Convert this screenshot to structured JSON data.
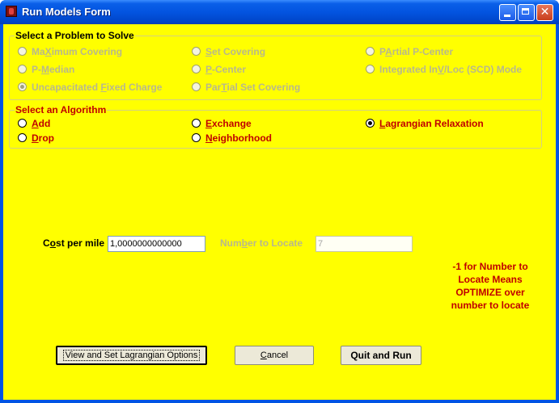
{
  "window": {
    "title": "Run Models Form",
    "controls": {
      "minimize": "minimize",
      "maximize": "maximize",
      "close": "✕"
    }
  },
  "problem_group": {
    "title": "Select a Problem to Solve",
    "options": [
      {
        "pre": "Ma",
        "u": "X",
        "post": "imum Covering",
        "selected": false
      },
      {
        "pre": "",
        "u": "S",
        "post": "et Covering",
        "selected": false
      },
      {
        "pre": "P",
        "u": "A",
        "post": "rtial P-Center",
        "selected": false
      },
      {
        "pre": "P-",
        "u": "M",
        "post": "edian",
        "selected": false
      },
      {
        "pre": "",
        "u": "P",
        "post": "-Center",
        "selected": false
      },
      {
        "pre": "Integrated In",
        "u": "V",
        "post": "/Loc (SCD) Mode",
        "selected": false
      },
      {
        "pre": "Uncapacitated ",
        "u": "F",
        "post": "ixed Charge",
        "selected": true
      },
      {
        "pre": "Par",
        "u": "T",
        "post": "ial Set Covering",
        "selected": false
      }
    ]
  },
  "algorithm_group": {
    "title": "Select an Algorithm",
    "options": [
      {
        "pre": "",
        "u": "A",
        "post": "dd",
        "selected": false
      },
      {
        "pre": "",
        "u": "E",
        "post": "xchange",
        "selected": false
      },
      {
        "pre": "",
        "u": "L",
        "post": "agrangian Relaxation",
        "selected": true
      },
      {
        "pre": "",
        "u": "D",
        "post": "rop",
        "selected": false
      },
      {
        "pre": "",
        "u": "N",
        "post": "eighborhood",
        "selected": false
      }
    ]
  },
  "cost_per_mile": {
    "label_pre": "C",
    "label_u": "o",
    "label_post": "st per mile",
    "value": "1,0000000000000"
  },
  "number_to_locate": {
    "label_pre": "Num",
    "label_u": "b",
    "label_post": "er to Locate",
    "value": "7"
  },
  "note": "-1 for Number to Locate Means OPTIMIZE over number to locate",
  "buttons": {
    "lagrangian": "View and Set Lagrangian Options",
    "cancel_pre": "",
    "cancel_u": "C",
    "cancel_post": "ancel",
    "quit": "Quit and Run"
  }
}
